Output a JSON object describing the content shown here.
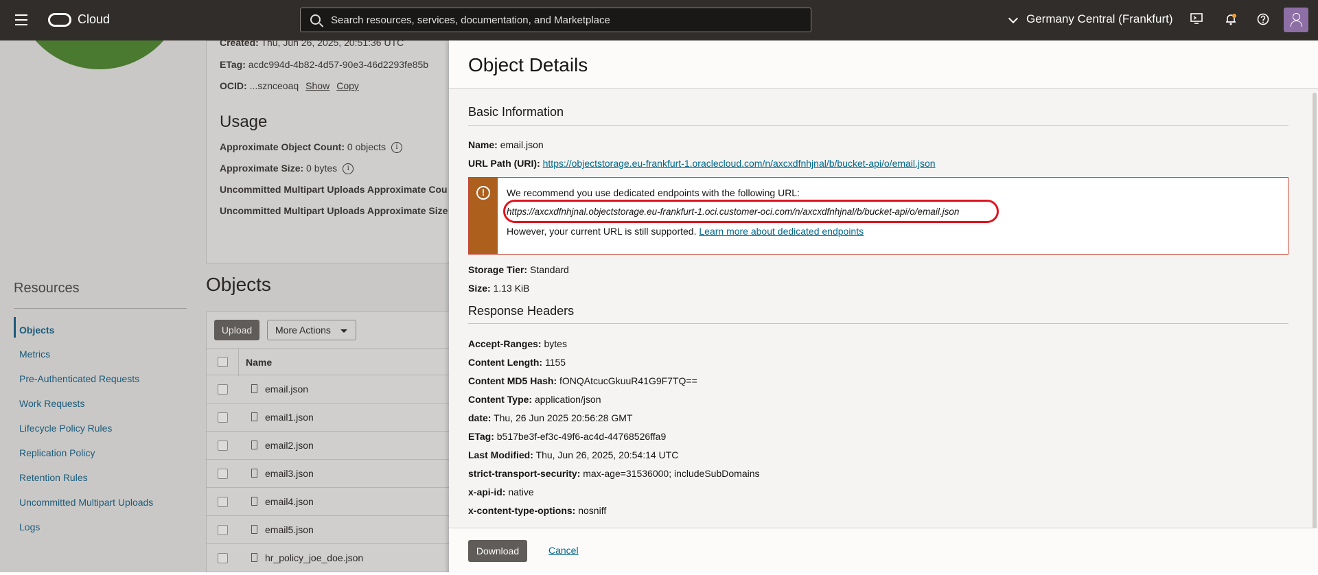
{
  "topbar": {
    "brand": "Cloud",
    "search_placeholder": "Search resources, services, documentation, and Marketplace",
    "region": "Germany Central (Frankfurt)"
  },
  "background": {
    "created_label": "Created:",
    "created_value": "Thu, Jun 26, 2025, 20:51:36 UTC",
    "etag_label": "ETag:",
    "etag_value": "acdc994d-4b82-4d57-90e3-46d2293fe85b",
    "ocid_label": "OCID:",
    "ocid_value": "...sznceoaq",
    "show": "Show",
    "copy": "Copy",
    "usage_title": "Usage",
    "approx_count_label": "Approximate Object Count:",
    "approx_count_value": "0 objects",
    "approx_size_label": "Approximate Size:",
    "approx_size_value": "0 bytes",
    "uncommitted_count": "Uncommitted Multipart Uploads Approximate Cou",
    "uncommitted_size": "Uncommitted Multipart Uploads Approximate Size",
    "resources_title": "Resources",
    "resources": [
      "Objects",
      "Metrics",
      "Pre-Authenticated Requests",
      "Work Requests",
      "Lifecycle Policy Rules",
      "Replication Policy",
      "Retention Rules",
      "Uncommitted Multipart Uploads",
      "Logs"
    ],
    "objects_title": "Objects",
    "upload": "Upload",
    "more_actions": "More Actions",
    "name_col": "Name",
    "files": [
      "email.json",
      "email1.json",
      "email2.json",
      "email3.json",
      "email4.json",
      "email5.json",
      "hr_policy_joe_doe.json"
    ]
  },
  "panel": {
    "title": "Object Details",
    "basic_info": "Basic Information",
    "name_label": "Name:",
    "name_value": "email.json",
    "url_label": "URL Path (URI):",
    "url_value": "https://objectstorage.eu-frankfurt-1.oraclecloud.com/n/axcxdfnhjnal/b/bucket-api/o/email.json",
    "notice_line1": "We recommend you use dedicated endpoints with the following URL:",
    "notice_url": "https://axcxdfnhjnal.objectstorage.eu-frankfurt-1.oci.customer-oci.com/n/axcxdfnhjnal/b/bucket-api/o/email.json",
    "notice_line3": "However, your current URL is still supported.",
    "notice_link": "Learn more about dedicated endpoints",
    "storage_tier_label": "Storage Tier:",
    "storage_tier_value": "Standard",
    "size_label": "Size:",
    "size_value": "1.13 KiB",
    "response_headers": "Response Headers",
    "headers": [
      {
        "k": "Accept-Ranges:",
        "v": "bytes"
      },
      {
        "k": "Content Length:",
        "v": "1155"
      },
      {
        "k": "Content MD5 Hash:",
        "v": "fONQAtcucGkuuR41G9F7TQ=="
      },
      {
        "k": "Content Type:",
        "v": "application/json"
      },
      {
        "k": "date:",
        "v": "Thu, 26 Jun 2025 20:56:28 GMT"
      },
      {
        "k": "ETag:",
        "v": "b517be3f-ef3c-49f6-ac4d-44768526ffa9"
      },
      {
        "k": "Last Modified:",
        "v": "Thu, Jun 26, 2025, 20:54:14 UTC"
      },
      {
        "k": "strict-transport-security:",
        "v": "max-age=31536000; includeSubDomains"
      },
      {
        "k": "x-api-id:",
        "v": "native"
      },
      {
        "k": "x-content-type-options:",
        "v": "nosniff"
      }
    ],
    "download": "Download",
    "cancel": "Cancel"
  }
}
